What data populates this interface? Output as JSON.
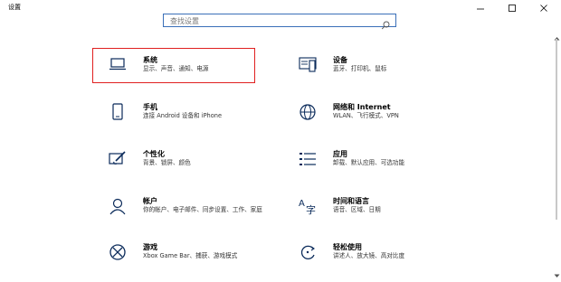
{
  "window": {
    "title": "设置",
    "minimize_icon": "minimize-icon",
    "maximize_icon": "maximize-icon",
    "close_icon": "close-icon"
  },
  "search": {
    "placeholder": "查找设置",
    "icon": "search-icon"
  },
  "settings_items": [
    {
      "id": "system",
      "title": "系统",
      "desc": "显示、声音、通知、电源",
      "icon": "laptop-icon",
      "highlighted": true
    },
    {
      "id": "devices",
      "title": "设备",
      "desc": "蓝牙、打印机、鼠标",
      "icon": "keyboard-devices-icon"
    },
    {
      "id": "phone",
      "title": "手机",
      "desc": "连接 Android 设备和 iPhone",
      "icon": "phone-icon"
    },
    {
      "id": "network",
      "title": "网络和 Internet",
      "desc": "WLAN、飞行模式、VPN",
      "icon": "globe-icon"
    },
    {
      "id": "personalization",
      "title": "个性化",
      "desc": "背景、锁屏、颜色",
      "icon": "paint-brush-icon"
    },
    {
      "id": "apps",
      "title": "应用",
      "desc": "卸载、默认应用、可选功能",
      "icon": "apps-list-icon"
    },
    {
      "id": "accounts",
      "title": "帐户",
      "desc": "你的帐户、电子邮件、同步设置、工作、家庭",
      "icon": "person-icon"
    },
    {
      "id": "time_language",
      "title": "时间和语言",
      "desc": "语音、区域、日期",
      "icon": "language-icon"
    },
    {
      "id": "gaming",
      "title": "游戏",
      "desc": "Xbox Game Bar、捕获、游戏模式",
      "icon": "xbox-icon"
    },
    {
      "id": "ease_of_access",
      "title": "轻松使用",
      "desc": "讲述人、放大镜、高对比度",
      "icon": "ease-of-access-icon"
    }
  ],
  "colors": {
    "accent": "#0063b1",
    "highlight_border": "#e02020",
    "search_border": "#3a6fb8"
  }
}
